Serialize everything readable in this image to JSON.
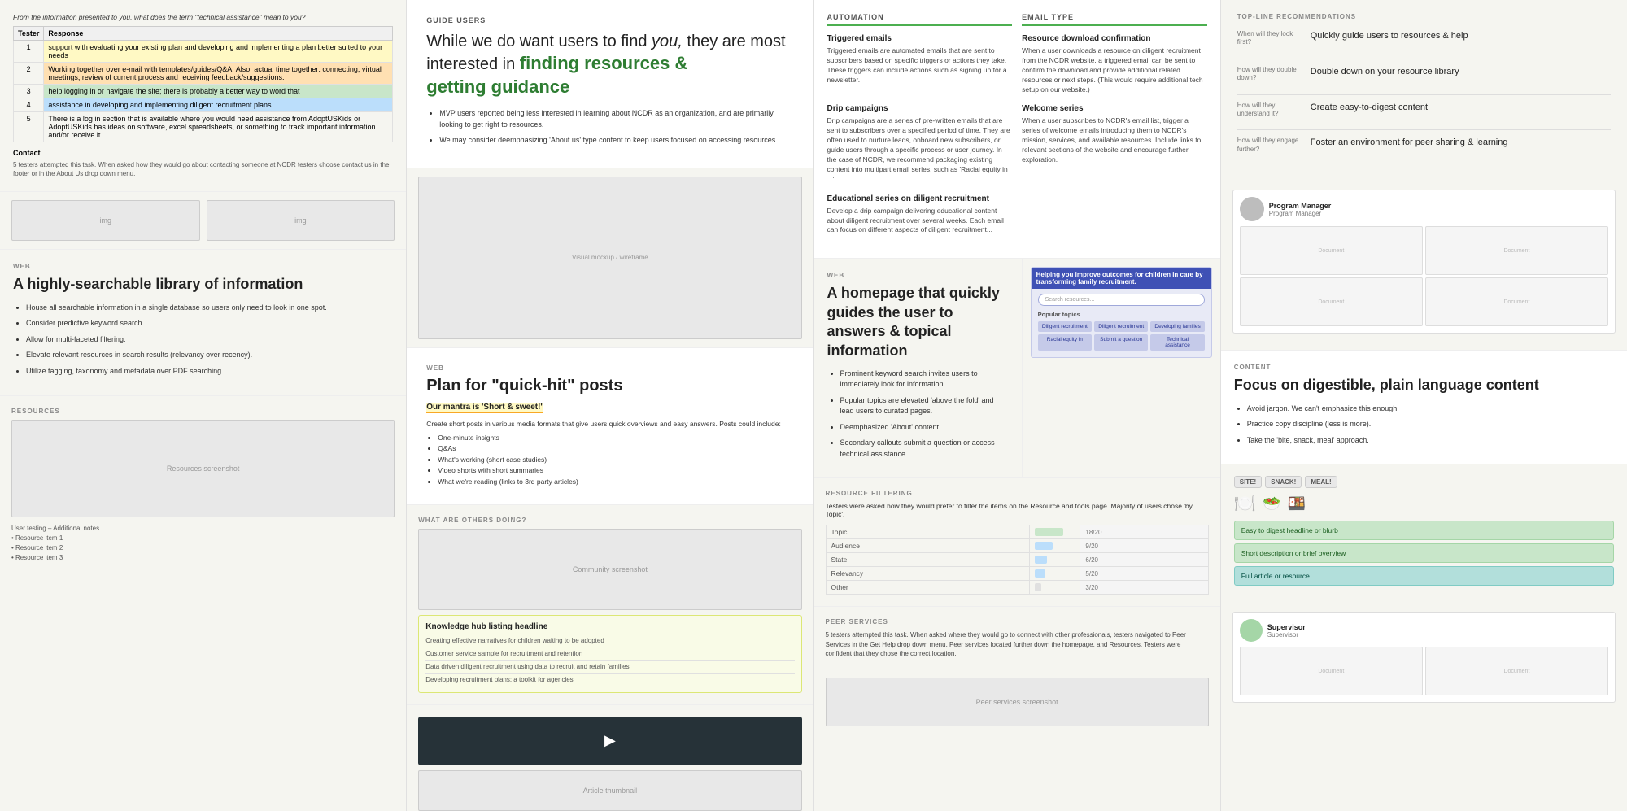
{
  "col1": {
    "usability": {
      "title": "From the information presented to you, what does the term 'technical assistance' mean to you?",
      "headers": [
        "Tester",
        "Response"
      ],
      "rows": [
        {
          "tester": "1",
          "text": "support with evaluating your existing plan and developing and implementing a plan better suited to your needs",
          "highlight": "yellow"
        },
        {
          "tester": "2",
          "text": "Working together over e-mail with templates/guides/Q&A. Also, actual time together: connecting, virtual meetings, review of current process and receiving feedback/suggestions.",
          "highlight": "orange"
        },
        {
          "tester": "3",
          "text": "help logging in or navigate the site; there is probably a better way to word that",
          "highlight": "green"
        },
        {
          "tester": "4",
          "text": "assistance in developing and implementing diligent recruitment plans",
          "highlight": "blue"
        },
        {
          "tester": "5",
          "text": "There is a log in section that is available where you would need assistance from AdoptUSKids or AdoptUSKids has ideas on software, excel spreadsheets, or something to track important information and/or receive it.",
          "highlight": "none"
        }
      ],
      "contact_label": "Contact",
      "contact_text": "5 testers attempted this task. When asked how they would go about contacting someone at NCDR testers choose contact us in the footer or in the About Us drop down menu."
    },
    "web_section": {
      "label": "WEB",
      "title": "A highly-searchable library of information",
      "bullets": [
        "House all searchable information in a single database so users only need to look in one spot.",
        "Consider predictive keyword search.",
        "Allow for multi-faceted filtering.",
        "Elevate relevant resources in search results (relevancy over recency).",
        "Utilize tagging, taxonomy and metadata over PDF searching."
      ]
    },
    "resources_label": "Resources",
    "bottom_section": {
      "items": [
        "Resource item 1",
        "Resource item 2",
        "Resource item 3"
      ]
    }
  },
  "col2": {
    "guide_users": {
      "label": "GUIDE USERS",
      "intro": "While we do want users to find",
      "intro_italic": "you,",
      "intro_cont": "they are most interested in",
      "highlight": "finding resources & getting guidance",
      "bullets": [
        "MVP users reported being less interested in learning about NCDR as an organization, and are primarily looking to get right to resources.",
        "We may consider deemphasizing 'About us' type content to keep users focused on accessing resources."
      ]
    },
    "web_section": {
      "label": "WEB",
      "title": "Plan for \"quick-hit\" posts",
      "mantra": "Our mantra is 'Short & sweet!'",
      "intro": "Create short posts in various media formats that give users quick overviews and easy answers. Posts could include:",
      "items": [
        "One-minute insights",
        "Q&As",
        "What's working (short case studies)",
        "Video shorts with short summaries",
        "What we're reading (links to 3rd party articles)"
      ]
    },
    "what_others_label": "what are others doing?",
    "knowledge_hub": {
      "headline": "Knowledge hub listing headline",
      "subtitle": "Creating effective narratives for children waiting to be adopted",
      "item2": "Customer service sample for recruitment and retention",
      "item3": "Data driven diligent recruitment using data to recruit and retain families",
      "item4": "Developing recruitment plans: a toolkit for agencies"
    }
  },
  "col3": {
    "automation": {
      "label": "AUTOMATION",
      "email_label": "EMAIL TYPE",
      "triggered_label": "Triggered emails",
      "triggered_text": "Triggered emails are automated emails that are sent to subscribers based on specific triggers or actions they take. These triggers can include actions such as signing up for a newsletter.",
      "download_label": "Resource download confirmation",
      "download_text": "When a user downloads a resource on diligent recruitment from the NCDR website, a triggered email can be sent to confirm the download and provide additional related resources or next steps. (This would require additional tech setup on our website.)",
      "drip_label": "Drip campaigns",
      "drip_text": "Drip campaigns are a series of pre-written emails that are sent to subscribers over a specified period of time. They are often used to nurture leads, onboard new subscribers, or guide users through a specific process or user journey. In the case of NCDR, we recommend packaging existing content into multipart email series, such as 'Racial equity in ...'",
      "welcome_label": "Welcome series",
      "welcome_text": "When a user subscribes to NCDR's email list, trigger a series of welcome emails introducing them to NCDR's mission, services, and available resources. Include links to relevant sections of the website and encourage further exploration.",
      "educational_label": "Educational series on diligent recruitment",
      "educational_text": "Develop a drip campaign delivering educational content about diligent recruitment over several weeks. Each email can focus on different aspects of diligent recruitment..."
    },
    "web_section": {
      "label": "WEB",
      "title": "A homepage that quickly guides the user to answers & topical information",
      "bullets": [
        "Prominent keyword search invites users to immediately look for information.",
        "Popular topics are elevated 'above the fold' and lead users to curated pages.",
        "Deemphasized 'About' content.",
        "Secondary callouts submit a question or access technical assistance."
      ]
    },
    "resource_filtering": {
      "label": "Resource Filtering",
      "note": "Testers were asked how they would prefer to filter the items on the Resource and tools page. Majority of users chose 'by Topic'.",
      "items": [
        {
          "label": "Topic",
          "value": ""
        },
        {
          "label": "Audience",
          "value": ""
        },
        {
          "label": "State",
          "value": ""
        },
        {
          "label": "Relevancy",
          "value": ""
        },
        {
          "label": "Other",
          "value": ""
        }
      ]
    },
    "peer_services": {
      "label": "Peer Services",
      "text": "5 testers attempted this task. When asked where they would go to connect with other professionals, testers navigated to Peer Services in the Get Help drop down menu. Peer services located further down the homepage, and Resources. Testers were confident that they chose the correct location."
    }
  },
  "col4": {
    "top_line": {
      "label": "TOP-LINE RECOMMENDATIONS",
      "items": [
        {
          "question": "When will they look first?",
          "text": "Quickly guide users to resources & help"
        },
        {
          "question": "How will they double down?",
          "text": "Double down on your resource library"
        },
        {
          "question": "How will they understand it?",
          "text": "Create easy-to-digest content"
        },
        {
          "question": "How will they engage further?",
          "text": "Foster an environment for peer sharing & learning"
        }
      ]
    },
    "program_manager": {
      "name": "Program Manager",
      "title": "Program Manager",
      "section_label": "Program Manager"
    },
    "content": {
      "label": "CONTENT",
      "title": "Focus on digestible, plain language content",
      "bullets": [
        "Avoid jargon. We can't emphasize this enough!",
        "Practice copy discipline (less is more).",
        "Take the 'bite, snack, meal' approach."
      ]
    },
    "snack_cards": {
      "labels": [
        "SITE!",
        "SNACK!",
        "MEAL!"
      ],
      "card1": "Easy to digest headline or blurb",
      "card2": "Short description or brief overview",
      "card3": "Full article or resource"
    },
    "supervisor": {
      "name": "Supervisor",
      "title": "Supervisor"
    }
  }
}
